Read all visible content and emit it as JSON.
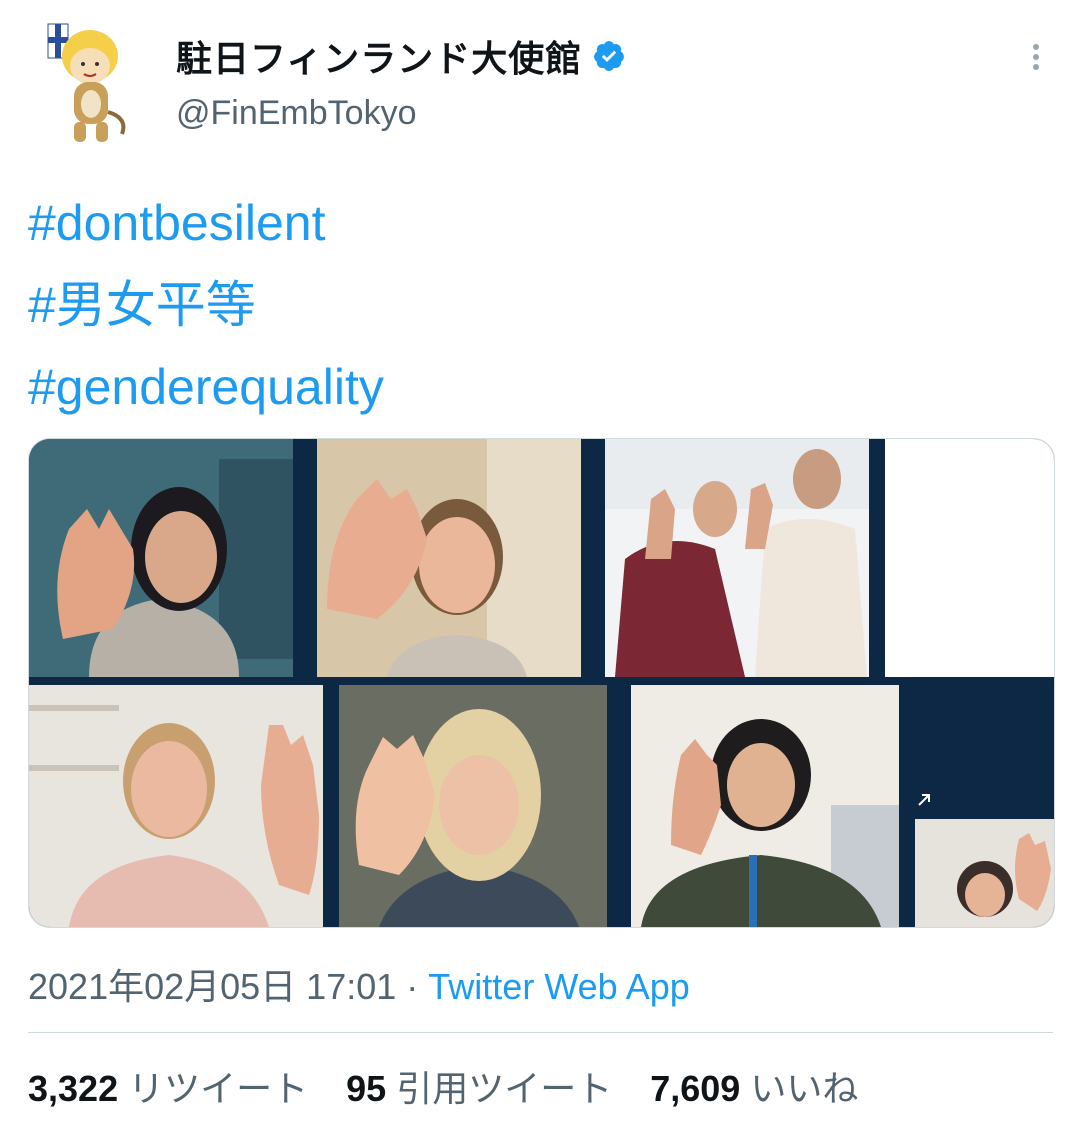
{
  "account": {
    "display_name": "駐日フィンランド大使館",
    "handle": "@FinEmbTokyo",
    "verified": true,
    "avatar_icon": "moomin-lion-mascot-with-finnish-flag"
  },
  "tweet": {
    "hashtags": [
      "#dontbesilent",
      "#男女平等",
      "#genderequality"
    ],
    "timestamp": "2021年02月05日 17:01",
    "separator": "·",
    "source": "Twitter Web App"
  },
  "stats": {
    "retweets_count": "3,322",
    "retweets_label": "リツイート",
    "quotes_count": "95",
    "quotes_label": "引用ツイート",
    "likes_count": "7,609",
    "likes_label": "いいね"
  },
  "media": {
    "description_icons": [
      "video-call-tile"
    ],
    "expand_icon": "expand-arrow-icon"
  },
  "colors": {
    "accent": "#1d9bf0",
    "text_primary": "#0f1419",
    "text_secondary": "#536471",
    "call_background": "#0c2845"
  }
}
